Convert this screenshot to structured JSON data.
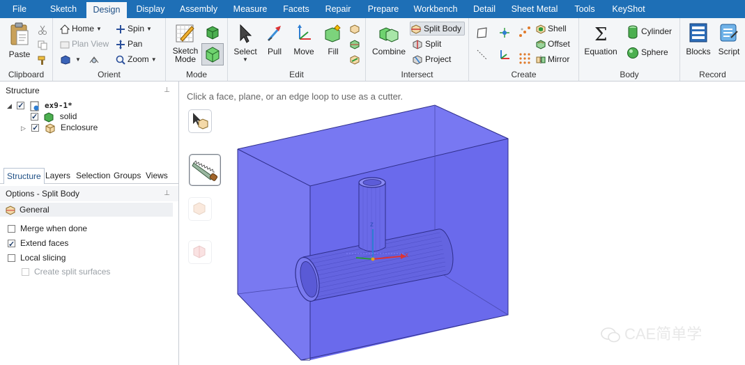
{
  "menu": {
    "items": [
      "File",
      "Sketch",
      "Design",
      "Display",
      "Assembly",
      "Measure",
      "Facets",
      "Repair",
      "Prepare",
      "Workbench",
      "Detail",
      "Sheet Metal",
      "Tools",
      "KeyShot"
    ],
    "active": "Design"
  },
  "ribbon": {
    "clipboard": {
      "label": "Clipboard",
      "paste": "Paste"
    },
    "orient": {
      "label": "Orient",
      "home": "Home",
      "plan_view": "Plan View",
      "spin": "Spin",
      "pan": "Pan",
      "zoom": "Zoom"
    },
    "mode": {
      "label": "Mode",
      "sketch_mode": "Sketch\nMode"
    },
    "edit": {
      "label": "Edit",
      "select": "Select",
      "pull": "Pull",
      "move": "Move",
      "fill": "Fill"
    },
    "intersect": {
      "label": "Intersect",
      "combine": "Combine",
      "split_body": "Split Body",
      "split": "Split",
      "project": "Project"
    },
    "create": {
      "label": "Create",
      "shell": "Shell",
      "offset": "Offset",
      "mirror": "Mirror"
    },
    "body": {
      "label": "Body",
      "equation": "Equation",
      "cylinder": "Cylinder",
      "sphere": "Sphere"
    },
    "record": {
      "label": "Record",
      "blocks": "Blocks",
      "script": "Script"
    }
  },
  "structure": {
    "title": "Structure",
    "root": "ex9-1*",
    "children": [
      "solid",
      "Enclosure"
    ]
  },
  "panel_tabs": [
    "Structure",
    "Layers",
    "Selection",
    "Groups",
    "Views"
  ],
  "active_tab": "Structure",
  "options": {
    "title": "Options - Split Body",
    "section": "General",
    "items": [
      {
        "label": "Merge when done",
        "checked": false,
        "disabled": false
      },
      {
        "label": "Extend faces",
        "checked": true,
        "disabled": false
      },
      {
        "label": "Local slicing",
        "checked": false,
        "disabled": false
      },
      {
        "label": "Create split surfaces",
        "checked": false,
        "disabled": true
      }
    ]
  },
  "viewport": {
    "hint": "Click a face, plane, or an edge loop to use as a cutter.",
    "axis_z": "z",
    "axis_x": "x"
  },
  "watermark": "CAE简单学",
  "colors": {
    "menubar": "#1e6fb6",
    "box_fill": "#7070ee",
    "box_edge": "#3a3aa0",
    "pipe_fill": "#6a6ae6"
  }
}
